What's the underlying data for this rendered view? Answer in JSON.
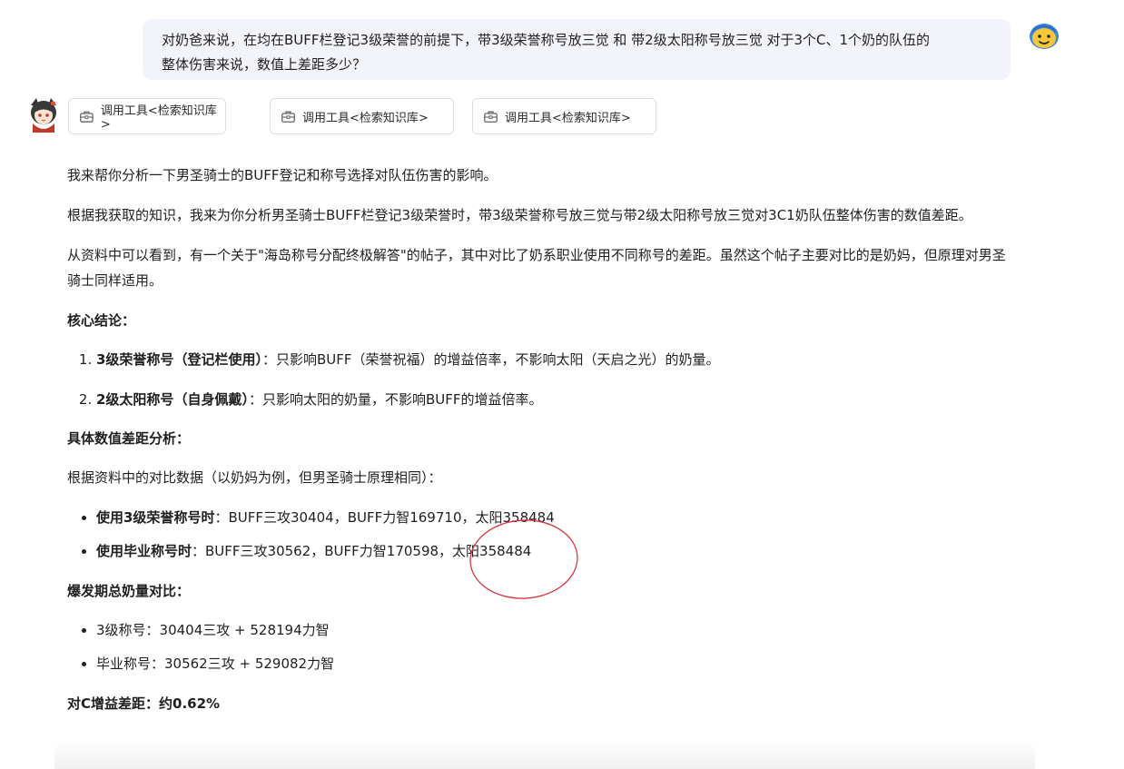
{
  "user_message": {
    "line1": "对奶爸来说，在均在BUFF栏登记3级荣誉的前提下，带3级荣誉称号放三觉 和 带2级太阳称号放三觉  对于3个C、1个奶的队伍的",
    "line2": "整体伤害来说，数值上差距多少？"
  },
  "tool_calls": [
    {
      "label": "调用工具<检索知识库>",
      "icon": "toolbox-icon"
    },
    {
      "label": "调用工具<检索知识库>",
      "icon": "toolbox-icon"
    },
    {
      "label": "调用工具<检索知识库>",
      "icon": "toolbox-icon"
    }
  ],
  "answer": {
    "intro": "我来帮你分析一下男圣骑士的BUFF登记和称号选择对队伍伤害的影响。",
    "para2": "根据我获取的知识，我来为你分析男圣骑士BUFF栏登记3级荣誉时，带3级荣誉称号放三觉与带2级太阳称号放三觉对3C1奶队伍整体伤害的数值差距。",
    "para3": "从资料中可以看到，有一个关于\"海岛称号分配终极解答\"的帖子，其中对比了奶系职业使用不同称号的差距。虽然这个帖子主要对比的是奶妈，但原理对男圣骑士同样适用。",
    "core_heading": "核心结论：",
    "conclusions": [
      {
        "bold": "3级荣誉称号（登记栏使用）",
        "text": "：只影响BUFF（荣誉祝福）的增益倍率，不影响太阳（天启之光）的奶量。"
      },
      {
        "bold": "2级太阳称号（自身佩戴）",
        "text": "：只影响太阳的奶量，不影响BUFF的增益倍率。"
      }
    ],
    "analysis_heading": "具体数值差距分析：",
    "analysis_intro": "根据资料中的对比数据（以奶妈为例，但男圣骑士原理相同）：",
    "comparisons": [
      {
        "bold": "使用3级荣誉称号时",
        "text": "：BUFF三攻30404，BUFF力智169710，太阳358484"
      },
      {
        "bold": "使用毕业称号时",
        "text": "：BUFF三攻30562，BUFF力智170598，太阳358484"
      }
    ],
    "burst_heading": "爆发期总奶量对比：",
    "burst_items": [
      "3级称号：30404三攻 + 528194力智",
      "毕业称号：30562三攻 + 529082力智"
    ],
    "diff": "对C增益差距：约0.62%"
  },
  "colors": {
    "user_bubble_bg": "#f3f4f9",
    "annotation_red": "#d9363e",
    "chip_border": "#dcdfe6"
  }
}
